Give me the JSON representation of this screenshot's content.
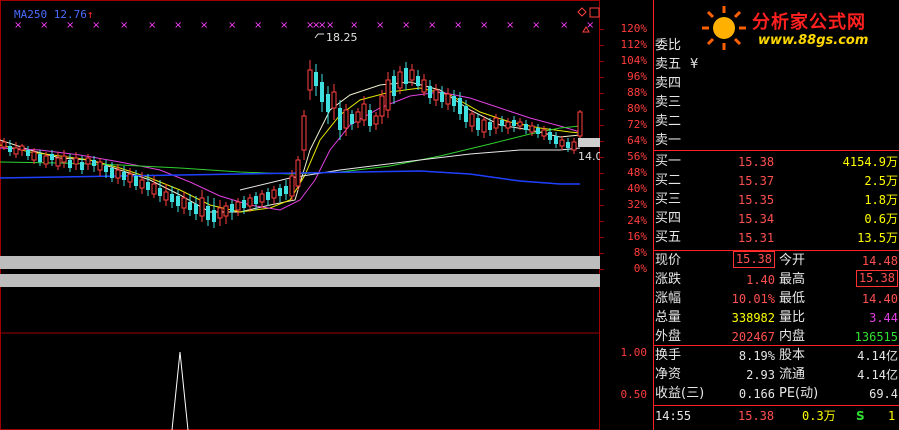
{
  "chart": {
    "ma_label": "MA250",
    "ma_value": "12.76",
    "arrow": "↑",
    "high_label": "18.25",
    "right_label": "14.0"
  },
  "axis": {
    "price_ticks": [
      "120%",
      "112%",
      "104%",
      "96%",
      "88%",
      "80%",
      "72%",
      "64%",
      "56%",
      "48%",
      "40%",
      "32%",
      "24%",
      "16%",
      "8%",
      "0%"
    ],
    "vol_ticks": [
      "1.00",
      "0.50"
    ]
  },
  "logo": {
    "title": "分析家公式网",
    "url": "www.88gs.com"
  },
  "panel": {
    "weibi": "委比",
    "yen": "¥",
    "sell": [
      {
        "label": "卖五"
      },
      {
        "label": "卖四"
      },
      {
        "label": "卖三"
      },
      {
        "label": "卖二"
      },
      {
        "label": "卖一"
      }
    ],
    "buy": [
      {
        "label": "买一",
        "price": "15.38",
        "vol": "4154.9万"
      },
      {
        "label": "买二",
        "price": "15.37",
        "vol": "2.5万"
      },
      {
        "label": "买三",
        "price": "15.35",
        "vol": "1.8万"
      },
      {
        "label": "买四",
        "price": "15.34",
        "vol": "0.6万"
      },
      {
        "label": "买五",
        "price": "15.31",
        "vol": "13.5万"
      }
    ],
    "quote": [
      {
        "l1": "现价",
        "v1": "15.38",
        "l2": "今开",
        "v2": "14.48"
      },
      {
        "l1": "涨跌",
        "v1": "1.40",
        "l2": "最高",
        "v2": "15.38"
      },
      {
        "l1": "涨幅",
        "v1": "10.01%",
        "l2": "最低",
        "v2": "14.40"
      },
      {
        "l1": "总量",
        "v1": "338982",
        "l2": "量比",
        "v2": "3.44"
      },
      {
        "l1": "外盘",
        "v1": "202467",
        "l2": "内盘",
        "v2": "136515"
      }
    ],
    "fin": [
      {
        "l1": "换手",
        "v1": "8.19%",
        "l2": "股本",
        "v2": "4.14亿"
      },
      {
        "l1": "净资",
        "v1": "2.93",
        "l2": "流通",
        "v2": "4.14亿"
      },
      {
        "l1": "收益(三)",
        "v1": "0.166",
        "l2": "PE(动)",
        "v2": "69.4"
      }
    ],
    "tick": {
      "time": "14:55",
      "price": "15.38",
      "vol": "0.3万",
      "side": "S",
      "count": "1"
    }
  }
}
